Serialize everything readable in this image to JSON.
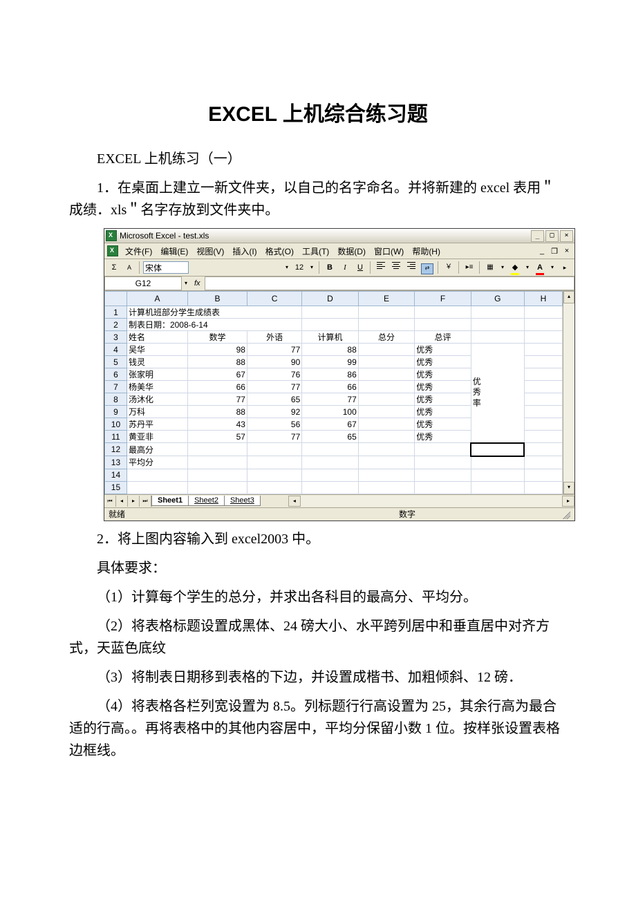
{
  "doc": {
    "title": "EXCEL 上机综合练习题",
    "subtitle": "EXCEL 上机练习（一）",
    "para1": "1．在桌面上建立一新文件夹，以自己的名字命名。并将新建的 excel 表用＂成绩．xls＂名字存放到文件夹中。",
    "para2": "2．将上图内容输入到 excel2003 中。",
    "para3": "具体要求：",
    "req1": "（1）计算每个学生的总分，并求出各科目的最高分、平均分。",
    "req2": "（2）将表格标题设置成黑体、24 磅大小、水平跨列居中和垂直居中对齐方式，天蓝色底纹",
    "req3": "（3）将制表日期移到表格的下边，并设置成楷书、加粗倾斜、12 磅．",
    "req4": "（4）将表格各栏列宽设置为 8.5。列标题行行高设置为 25，其余行高为最合适的行高。。再将表格中的其他内容居中，平均分保留小数 1 位。按样张设置表格边框线。"
  },
  "excel": {
    "titlebar": "Microsoft Excel - test.xls",
    "menus": {
      "file": "文件(F)",
      "edit": "编辑(E)",
      "view": "视图(V)",
      "insert": "插入(I)",
      "format": "格式(O)",
      "tools": "工具(T)",
      "data": "数据(D)",
      "window": "窗口(W)",
      "help": "帮助(H)"
    },
    "toolbar": {
      "sigma": "Σ",
      "font": "宋体",
      "size": "12",
      "bold": "B",
      "italic": "I",
      "underline": "U",
      "fontA": "A"
    },
    "namebox": "G12",
    "fx": "fx",
    "cols": [
      "A",
      "B",
      "C",
      "D",
      "E",
      "F",
      "G",
      "H"
    ],
    "rows": [
      "1",
      "2",
      "3",
      "4",
      "5",
      "6",
      "7",
      "8",
      "9",
      "10",
      "11",
      "12",
      "13",
      "14",
      "15"
    ],
    "cells": {
      "a1": "计算机班部分学生成绩表",
      "a2": "制表日期：2008-6-14",
      "a3": "姓名",
      "b3": "数学",
      "c3": "外语",
      "d3": "计算机",
      "e3": "总分",
      "f3": "总评",
      "a4": "吴华",
      "b4": "98",
      "c4": "77",
      "d4": "88",
      "f4": "优秀",
      "a5": "钱灵",
      "b5": "88",
      "c5": "90",
      "d5": "99",
      "f5": "优秀",
      "a6": "张家明",
      "b6": "67",
      "c6": "76",
      "d6": "86",
      "f6": "优秀",
      "a7": "杨美华",
      "b7": "66",
      "c7": "77",
      "d7": "66",
      "f7": "优秀",
      "a8": "汤沐化",
      "b8": "77",
      "c8": "65",
      "d8": "77",
      "f8": "优秀",
      "a9": "万科",
      "b9": "88",
      "c9": "92",
      "d9": "100",
      "f9": "优秀",
      "a10": "苏丹平",
      "b10": "43",
      "c10": "56",
      "d10": "67",
      "f10": "优秀",
      "a11": "黄亚非",
      "b11": "57",
      "c11": "77",
      "d11": "65",
      "f11": "优秀",
      "a12": "最高分",
      "a13": "平均分",
      "g_vert1": "优",
      "g_vert2": "秀",
      "g_vert3": "率"
    },
    "sheets": {
      "s1": "Sheet1",
      "s2": "Sheet2",
      "s3": "Sheet3"
    },
    "status": {
      "ready": "就绪",
      "mode": "数字"
    }
  }
}
